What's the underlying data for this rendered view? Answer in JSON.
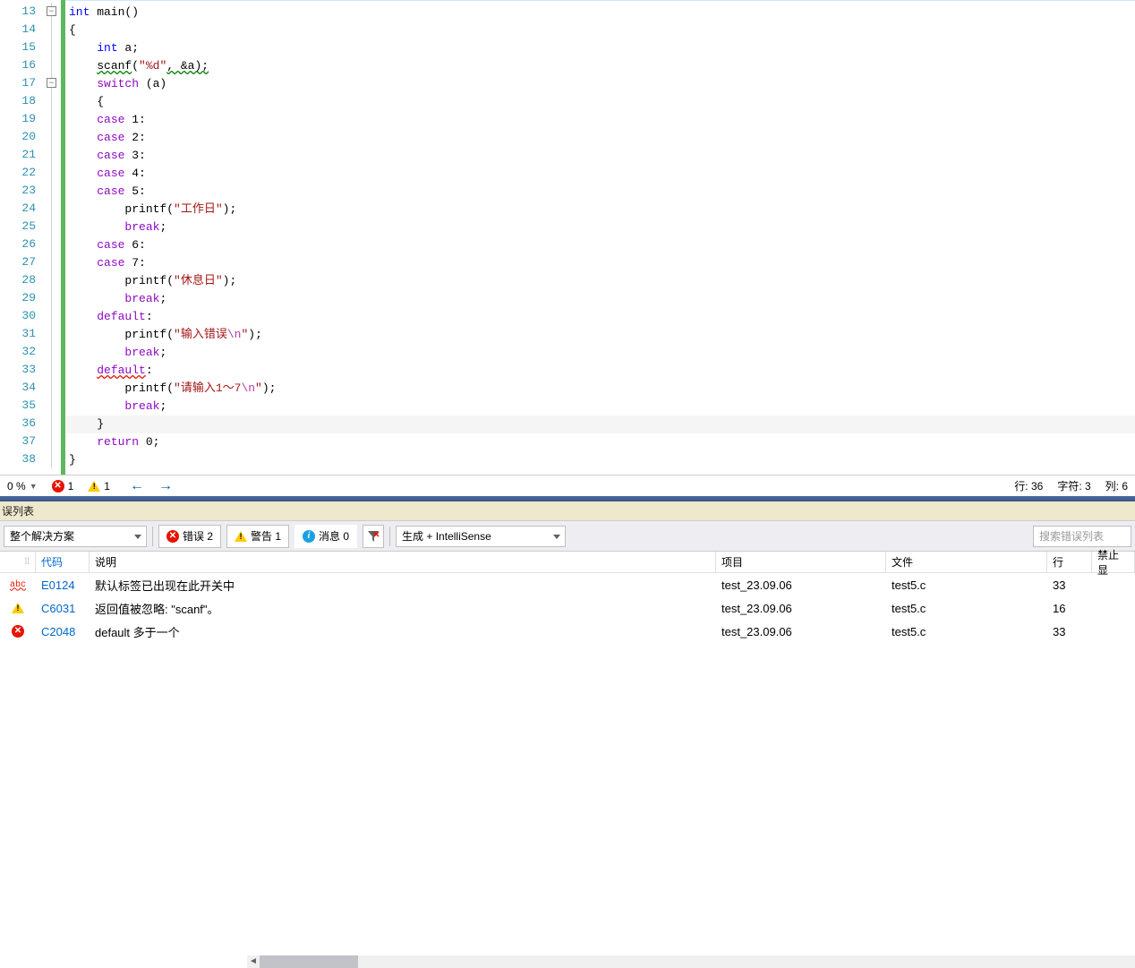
{
  "editor": {
    "startLine": 13,
    "foldBoxes": [
      {
        "line": 13,
        "glyph": "−"
      },
      {
        "line": 17,
        "glyph": "−"
      }
    ],
    "highlightLine": 36,
    "lines": [
      {
        "tokens": [
          {
            "t": "int",
            "c": "typ"
          },
          {
            "t": " main()"
          }
        ]
      },
      {
        "tokens": [
          {
            "t": "{"
          }
        ]
      },
      {
        "indent": 1,
        "tokens": [
          {
            "t": "int",
            "c": "typ"
          },
          {
            "t": " a;"
          }
        ]
      },
      {
        "indent": 1,
        "tokens": [
          {
            "t": "scanf",
            "c": "wavy-green"
          },
          {
            "t": "("
          },
          {
            "t": "\"%d\"",
            "c": "str"
          },
          {
            "t": ", &a);",
            "c": "wavy-green"
          }
        ]
      },
      {
        "indent": 1,
        "tokens": [
          {
            "t": "switch",
            "c": "sw"
          },
          {
            "t": " (a)"
          }
        ]
      },
      {
        "indent": 1,
        "tokens": [
          {
            "t": "{"
          }
        ]
      },
      {
        "indent": 1,
        "tokens": [
          {
            "t": "case",
            "c": "sw"
          },
          {
            "t": " 1:"
          }
        ]
      },
      {
        "indent": 1,
        "tokens": [
          {
            "t": "case",
            "c": "sw"
          },
          {
            "t": " 2:"
          }
        ]
      },
      {
        "indent": 1,
        "tokens": [
          {
            "t": "case",
            "c": "sw"
          },
          {
            "t": " 3:"
          }
        ]
      },
      {
        "indent": 1,
        "tokens": [
          {
            "t": "case",
            "c": "sw"
          },
          {
            "t": " 4:"
          }
        ]
      },
      {
        "indent": 1,
        "tokens": [
          {
            "t": "case",
            "c": "sw"
          },
          {
            "t": " 5:"
          }
        ]
      },
      {
        "indent": 2,
        "tokens": [
          {
            "t": "printf("
          },
          {
            "t": "\"工作日\"",
            "c": "str"
          },
          {
            "t": ");"
          }
        ]
      },
      {
        "indent": 2,
        "tokens": [
          {
            "t": "break",
            "c": "brk"
          },
          {
            "t": ";"
          }
        ]
      },
      {
        "indent": 1,
        "tokens": [
          {
            "t": "case",
            "c": "sw"
          },
          {
            "t": " 6:"
          }
        ]
      },
      {
        "indent": 1,
        "tokens": [
          {
            "t": "case",
            "c": "sw"
          },
          {
            "t": " 7:"
          }
        ]
      },
      {
        "indent": 2,
        "tokens": [
          {
            "t": "printf("
          },
          {
            "t": "\"休息日\"",
            "c": "str"
          },
          {
            "t": ");"
          }
        ]
      },
      {
        "indent": 2,
        "tokens": [
          {
            "t": "break",
            "c": "brk"
          },
          {
            "t": ";"
          }
        ]
      },
      {
        "indent": 1,
        "tokens": [
          {
            "t": "default",
            "c": "sw"
          },
          {
            "t": ":"
          }
        ]
      },
      {
        "indent": 2,
        "tokens": [
          {
            "t": "printf("
          },
          {
            "t": "\"输入错误",
            "c": "str"
          },
          {
            "t": "\\n",
            "c": "esc"
          },
          {
            "t": "\"",
            "c": "str"
          },
          {
            "t": ");"
          }
        ]
      },
      {
        "indent": 2,
        "tokens": [
          {
            "t": "break",
            "c": "brk"
          },
          {
            "t": ";"
          }
        ]
      },
      {
        "indent": 1,
        "tokens": [
          {
            "t": "default",
            "c": "sw wavy-red"
          },
          {
            "t": ":"
          }
        ]
      },
      {
        "indent": 2,
        "tokens": [
          {
            "t": "printf("
          },
          {
            "t": "\"请输入1～7",
            "c": "str"
          },
          {
            "t": "\\n",
            "c": "esc"
          },
          {
            "t": "\"",
            "c": "str"
          },
          {
            "t": ");"
          }
        ]
      },
      {
        "indent": 2,
        "tokens": [
          {
            "t": "break",
            "c": "brk"
          },
          {
            "t": ";"
          }
        ]
      },
      {
        "indent": 1,
        "tokens": [
          {
            "t": "}"
          }
        ]
      },
      {
        "indent": 1,
        "tokens": [
          {
            "t": "return",
            "c": "brk"
          },
          {
            "t": " 0;"
          }
        ]
      },
      {
        "tokens": [
          {
            "t": "}"
          }
        ]
      }
    ]
  },
  "statusBar": {
    "zoom": "0 %",
    "errCount": "1",
    "warnCount": "1",
    "line": "行: 36",
    "char": "字符: 3",
    "col": "列: 6"
  },
  "errorList": {
    "title": "误列表",
    "solutionDropdown": "整个解决方案",
    "errorsBtn": "错误 2",
    "warningsBtn": "警告 1",
    "messagesBtn": "消息 0",
    "sourceDropdown": "生成 + IntelliSense",
    "searchPlaceholder": "搜索错误列表",
    "headers": {
      "code": "代码",
      "description": "说明",
      "project": "项目",
      "file": "文件",
      "line": "行",
      "suppress": "禁止显"
    },
    "rows": [
      {
        "icon": "abc",
        "code": "E0124",
        "desc": "默认标签已出现在此开关中",
        "project": "test_23.09.06",
        "file": "test5.c",
        "line": "33"
      },
      {
        "icon": "warn",
        "code": "C6031",
        "desc": "返回值被忽略: \"scanf\"。",
        "project": "test_23.09.06",
        "file": "test5.c",
        "line": "16"
      },
      {
        "icon": "err",
        "code": "C2048",
        "desc": "default 多于一个",
        "project": "test_23.09.06",
        "file": "test5.c",
        "line": "33"
      }
    ]
  }
}
